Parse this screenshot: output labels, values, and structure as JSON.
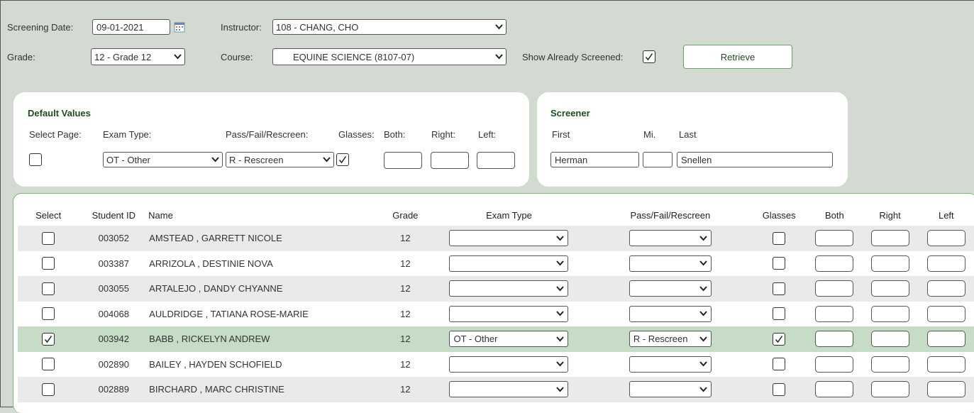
{
  "filters": {
    "screening_date_label": "Screening Date:",
    "screening_date_value": "09-01-2021",
    "instructor_label": "Instructor:",
    "instructor_value": "108 - CHANG, CHO",
    "grade_label": "Grade:",
    "grade_value": "12 - Grade 12",
    "course_label": "Course:",
    "course_value": "EQUINE SCIENCE (8107-07)",
    "show_screened_label": "Show Already Screened:",
    "show_screened_checked": true,
    "retrieve_label": "Retrieve"
  },
  "defaults": {
    "title": "Default Values",
    "select_page_label": "Select Page:",
    "exam_type_label": "Exam Type:",
    "exam_type_value": "OT - Other",
    "pass_fail_label": "Pass/Fail/Rescreen:",
    "pass_fail_value": "R - Rescreen",
    "glasses_label": "Glasses:",
    "glasses_checked": true,
    "both_label": "Both:",
    "right_label": "Right:",
    "left_label": "Left:"
  },
  "screener": {
    "title": "Screener",
    "first_label": "First",
    "mi_label": "Mi.",
    "last_label": "Last",
    "first_value": "Herman",
    "mi_value": "",
    "last_value": "Snellen"
  },
  "table": {
    "headers": {
      "select": "Select",
      "student_id": "Student ID",
      "name": "Name",
      "grade": "Grade",
      "exam_type": "Exam Type",
      "pass_fail": "Pass/Fail/Rescreen",
      "glasses": "Glasses",
      "both": "Both",
      "right": "Right",
      "left": "Left"
    },
    "rows": [
      {
        "selected": false,
        "id": "003052",
        "name": "AMSTEAD , GARRETT NICOLE",
        "grade": "12",
        "exam": "",
        "pass": "",
        "glasses": false
      },
      {
        "selected": false,
        "id": "003387",
        "name": "ARRIZOLA , DESTINIE NOVA",
        "grade": "12",
        "exam": "",
        "pass": "",
        "glasses": false
      },
      {
        "selected": false,
        "id": "003055",
        "name": "ARTALEJO , DANDY CHYANNE",
        "grade": "12",
        "exam": "",
        "pass": "",
        "glasses": false
      },
      {
        "selected": false,
        "id": "004068",
        "name": "AULDRIDGE , TATIANA ROSE-MARIE",
        "grade": "12",
        "exam": "",
        "pass": "",
        "glasses": false
      },
      {
        "selected": true,
        "id": "003942",
        "name": "BABB , RICKELYN ANDREW",
        "grade": "12",
        "exam": "OT - Other",
        "pass": "R - Rescreen",
        "glasses": true
      },
      {
        "selected": false,
        "id": "002890",
        "name": "BAILEY , HAYDEN SCHOFIELD",
        "grade": "12",
        "exam": "",
        "pass": "",
        "glasses": false
      },
      {
        "selected": false,
        "id": "002889",
        "name": "BIRCHARD , MARC CHRISTINE",
        "grade": "12",
        "exam": "",
        "pass": "",
        "glasses": false
      }
    ]
  }
}
